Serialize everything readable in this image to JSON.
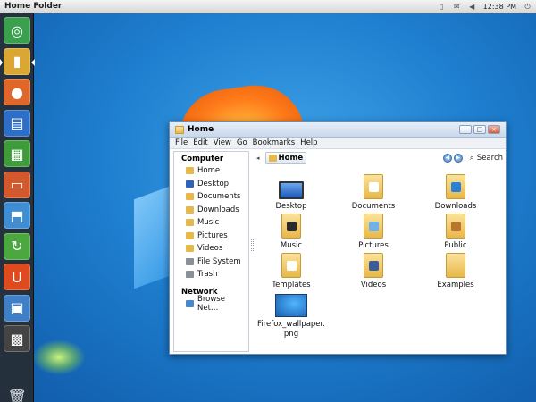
{
  "panel": {
    "title": "Home Folder",
    "clock": "12:38 PM",
    "tray_icons": [
      "battery-icon",
      "mail-icon",
      "volume-icon",
      "power-icon"
    ]
  },
  "launcher": {
    "items": [
      {
        "name": "ubuntu-logo-icon",
        "color": "#3aa04e",
        "glyph": "◎"
      },
      {
        "name": "home-folder-icon",
        "color": "#d9a732",
        "glyph": "▮"
      },
      {
        "name": "firefox-icon",
        "color": "#e0672a",
        "glyph": "●"
      },
      {
        "name": "writer-icon",
        "color": "#2d6ec9",
        "glyph": "▤"
      },
      {
        "name": "calc-icon",
        "color": "#3f9c3a",
        "glyph": "▦"
      },
      {
        "name": "impress-icon",
        "color": "#d3582b",
        "glyph": "▭"
      },
      {
        "name": "software-center-icon",
        "color": "#3e8ed6",
        "glyph": "⬒"
      },
      {
        "name": "update-manager-icon",
        "color": "#4aa83f",
        "glyph": "↻"
      },
      {
        "name": "ubuntu-one-icon",
        "color": "#dd4b1e",
        "glyph": "U"
      },
      {
        "name": "workspaces-icon",
        "color": "#3f7fc6",
        "glyph": "▣"
      },
      {
        "name": "system-settings-icon",
        "color": "#444444",
        "glyph": "▩"
      }
    ],
    "trash_icon": "trash-icon"
  },
  "window": {
    "title": "Home",
    "menu": [
      "File",
      "Edit",
      "View",
      "Go",
      "Bookmarks",
      "Help"
    ],
    "sidebar": {
      "computer_heading": "Computer",
      "places": [
        {
          "label": "Home",
          "icon": "home-icon",
          "color": "#e8b94a"
        },
        {
          "label": "Desktop",
          "icon": "desktop-icon",
          "color": "#2f62b8"
        },
        {
          "label": "Documents",
          "icon": "documents-icon",
          "color": "#e8b94a"
        },
        {
          "label": "Downloads",
          "icon": "downloads-icon",
          "color": "#e8b94a"
        },
        {
          "label": "Music",
          "icon": "music-icon",
          "color": "#e8b94a"
        },
        {
          "label": "Pictures",
          "icon": "pictures-icon",
          "color": "#e8b94a"
        },
        {
          "label": "Videos",
          "icon": "videos-icon",
          "color": "#e8b94a"
        },
        {
          "label": "File System",
          "icon": "filesystem-icon",
          "color": "#8a9099"
        },
        {
          "label": "Trash",
          "icon": "trash-icon",
          "color": "#8a9099"
        }
      ],
      "network_heading": "Network",
      "network": [
        {
          "label": "Browse Net…",
          "icon": "network-icon",
          "color": "#4a86c8"
        }
      ]
    },
    "path": {
      "crumb": "Home",
      "search_label": "Search"
    },
    "files": [
      {
        "label": "Desktop",
        "kind": "monitor",
        "badge_color": ""
      },
      {
        "label": "Documents",
        "kind": "folder",
        "badge_color": "#ffffff"
      },
      {
        "label": "Downloads",
        "kind": "folder",
        "badge_color": "#2b7fd4"
      },
      {
        "label": "Music",
        "kind": "folder",
        "badge_color": "#2b2b2b"
      },
      {
        "label": "Pictures",
        "kind": "folder",
        "badge_color": "#6fb1e8"
      },
      {
        "label": "Public",
        "kind": "folder",
        "badge_color": "#b8752e"
      },
      {
        "label": "Templates",
        "kind": "folder",
        "badge_color": "#ffffff"
      },
      {
        "label": "Videos",
        "kind": "folder",
        "badge_color": "#3a5d9a"
      },
      {
        "label": "Examples",
        "kind": "folder",
        "badge_color": ""
      },
      {
        "label": "Firefox_wallpaper.png",
        "kind": "image",
        "badge_color": ""
      }
    ]
  }
}
